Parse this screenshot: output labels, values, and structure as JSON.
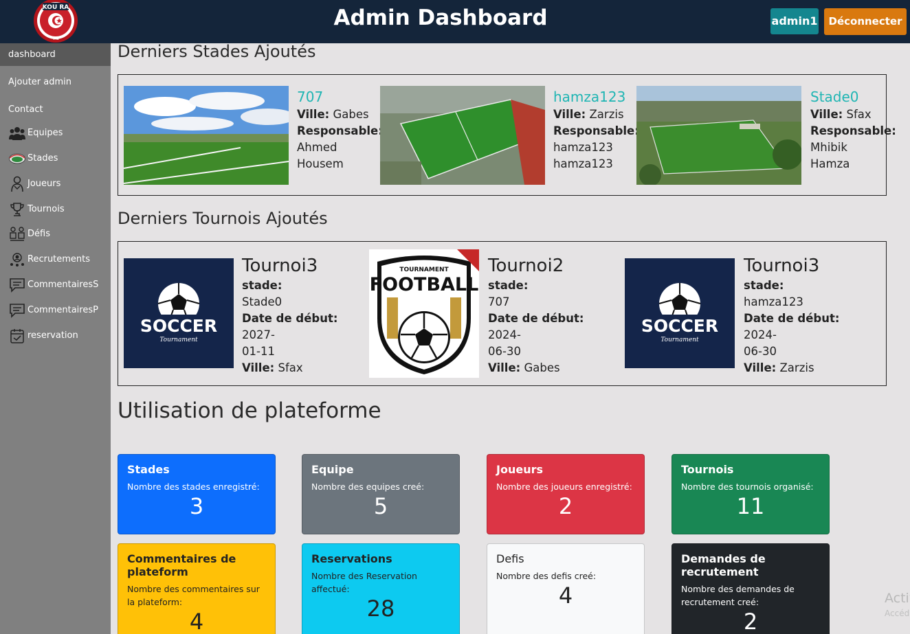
{
  "header": {
    "title": "Admin Dashboard",
    "user_label": "admin1",
    "logout_label": "Déconnecter",
    "logo_text": "KOU RA",
    "logo_sub": "TN"
  },
  "sidebar": {
    "items": [
      {
        "label": "dashboard",
        "icon": ""
      },
      {
        "label": "Ajouter admin",
        "icon": ""
      },
      {
        "label": "Contact",
        "icon": ""
      },
      {
        "label": "Equipes",
        "icon": "team-icon"
      },
      {
        "label": "Stades",
        "icon": "stadium-icon"
      },
      {
        "label": "Joueurs",
        "icon": "player-icon"
      },
      {
        "label": "Tournois",
        "icon": "trophy-icon"
      },
      {
        "label": "Défis",
        "icon": "challenge-icon"
      },
      {
        "label": "Recrutements",
        "icon": "recruit-icon"
      },
      {
        "label": "CommentairesS",
        "icon": "comment-icon"
      },
      {
        "label": "CommentairesP",
        "icon": "comment-icon"
      },
      {
        "label": "reservation",
        "icon": "calendar-icon"
      }
    ]
  },
  "stades_section": {
    "title": "Derniers Stades Ajoutés",
    "ville_label": "Ville:",
    "responsable_label": "Responsable:",
    "items": [
      {
        "name": "707",
        "ville": "Gabes",
        "resp1": "Ahmed",
        "resp2": "Housem"
      },
      {
        "name": "hamza123",
        "ville": "Zarzis",
        "resp1": "hamza123",
        "resp2": "hamza123"
      },
      {
        "name": "Stade0",
        "ville": "Sfax",
        "resp1": "Mhibik",
        "resp2": "Hamza"
      }
    ]
  },
  "tournois_section": {
    "title": "Derniers Tournois Ajoutés",
    "stade_label": "stade:",
    "date_label": "Date de début:",
    "ville_label": "Ville:",
    "items": [
      {
        "name": "Tournoi3",
        "stade": "Stade0",
        "date1": "2027-",
        "date2": "01-11",
        "ville": "Sfax",
        "poster_top": "SOCCER",
        "poster_sub": "Tournament"
      },
      {
        "name": "Tournoi2",
        "stade": "707",
        "date1": "2024-",
        "date2": "06-30",
        "ville": "Gabes",
        "poster_top": "TOURNAMENT",
        "poster_sub": "FOOTBALL"
      },
      {
        "name": "Tournoi3",
        "stade": "hamza123",
        "date1": "2024-",
        "date2": "06-30",
        "ville": "Zarzis",
        "poster_top": "SOCCER",
        "poster_sub": "Tournament"
      }
    ]
  },
  "stats": {
    "title": "Utilisation de plateforme",
    "cards": [
      {
        "title": "Stades",
        "sub": "Nombre des stades enregistré:",
        "value": "3",
        "color": "#0d6efd"
      },
      {
        "title": "Equipe",
        "sub": "Nombre des equipes creé:",
        "value": "5",
        "color": "#6c757d"
      },
      {
        "title": "Joueurs",
        "sub": "Nombre des joueurs enregistré:",
        "value": "2",
        "color": "#dc3545"
      },
      {
        "title": "Tournois",
        "sub": "Nombre des tournois organisé:",
        "value": "11",
        "color": "#198754"
      },
      {
        "title": "Commentaires de plateform",
        "sub": "Nombre des commentaires sur la plateform:",
        "value": "4",
        "color": "#ffc107"
      },
      {
        "title": "Reservations",
        "sub": "Nombre des Reservation affectué:",
        "value": "28",
        "color": "#0dcaf0"
      },
      {
        "title": "Defis",
        "sub": "Nombre des defis creé:",
        "value": "4",
        "color": "#f8f9fa"
      },
      {
        "title": "Demandes de recrutement",
        "sub": "Nombre des demandes de recrutement creé:",
        "value": "2",
        "color": "#212529"
      }
    ]
  },
  "watermark": {
    "line1": "Activ",
    "line2": "Accéd"
  }
}
